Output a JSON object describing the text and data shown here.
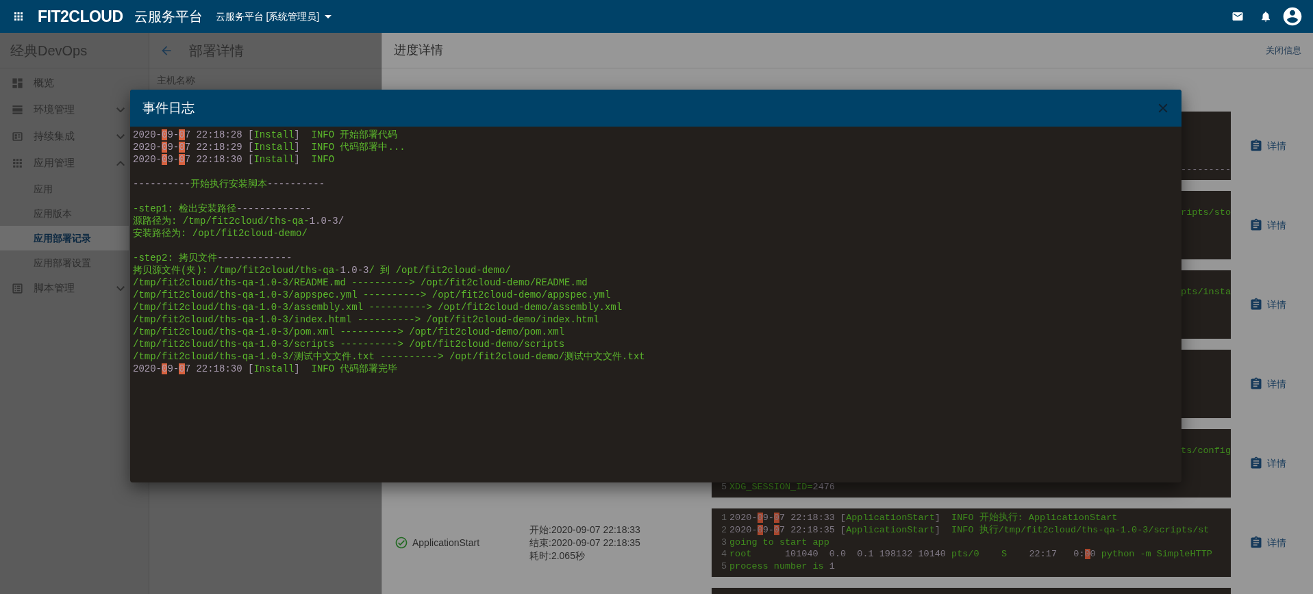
{
  "topbar": {
    "logo": "FIT2CLOUD",
    "title": "云服务平台",
    "workspace": "云服务平台 [系统管理员]"
  },
  "sidebar": {
    "title": "经典DevOps",
    "items": [
      {
        "label": "概览",
        "selected": false
      },
      {
        "label": "环境管理",
        "selected": false,
        "expanded": false
      },
      {
        "label": "持续集成",
        "selected": false,
        "expanded": false
      },
      {
        "label": "应用管理",
        "selected": false,
        "expanded": true,
        "children": [
          {
            "label": "应用",
            "selected": false
          },
          {
            "label": "应用版本",
            "selected": false
          },
          {
            "label": "应用部署记录",
            "selected": true
          },
          {
            "label": "应用部署设置",
            "selected": false
          }
        ]
      },
      {
        "label": "脚本管理",
        "selected": false,
        "expanded": false
      }
    ]
  },
  "detail_panel": {
    "title": "部署详情",
    "field_label": "主机名称"
  },
  "progress": {
    "title": "进度详情",
    "close_label": "关闭信息",
    "rows": [
      {
        "output": [
          {
            "segments": [
              {
                "kind": "dim",
                "text": "---------"
              }
            ]
          }
        ],
        "detail": "详情"
      },
      {
        "output": [
          {
            "segments": [
              {
                "kind": "green",
                "text": "ripts/sto"
              }
            ]
          }
        ],
        "detail": "详情"
      },
      {
        "output": [
          {
            "segments": [
              {
                "kind": "green",
                "text": "pts/insta"
              }
            ]
          }
        ],
        "detail": "详情"
      },
      {
        "detail": "详情"
      },
      {
        "output": [
          {
            "segments": [
              {
                "kind": "green",
                "text": "ts/config"
              }
            ]
          },
          {
            "number": "5",
            "segments": [
              {
                "kind": "green",
                "text": "XDG_SESSION_ID="
              },
              {
                "kind": "dim",
                "text": "2476"
              }
            ]
          }
        ],
        "detail": "详情"
      },
      {
        "event": "ApplicationStart",
        "completed": true,
        "times": [
          "开始:2020-09-07 22:18:33",
          "结束:2020-09-07 22:18:35",
          "耗时:2.065秒"
        ],
        "output": [
          {
            "number": "1",
            "segments": [
              {
                "kind": "dim",
                "text": "2020-"
              },
              {
                "kind": "mark",
                "text": "0"
              },
              {
                "kind": "dim",
                "text": "9-"
              },
              {
                "kind": "mark",
                "text": "0"
              },
              {
                "kind": "dim",
                "text": "7 22:18:33 ["
              },
              {
                "kind": "green",
                "text": "ApplicationStart"
              },
              {
                "kind": "dim",
                "text": "]"
              },
              {
                "kind": "green",
                "text": "  INFO 开始执行: ApplicationStart"
              }
            ]
          },
          {
            "number": "2",
            "segments": [
              {
                "kind": "dim",
                "text": "2020-"
              },
              {
                "kind": "mark",
                "text": "0"
              },
              {
                "kind": "dim",
                "text": "9-"
              },
              {
                "kind": "mark",
                "text": "0"
              },
              {
                "kind": "dim",
                "text": "7 22:18:35 ["
              },
              {
                "kind": "green",
                "text": "ApplicationStart"
              },
              {
                "kind": "dim",
                "text": "]"
              },
              {
                "kind": "green",
                "text": "  INFO 执行/tmp/fit2cloud/ths-qa-1.0-3/scripts/st"
              }
            ]
          },
          {
            "number": "3",
            "segments": [
              {
                "kind": "green",
                "text": "going to start app"
              }
            ]
          },
          {
            "number": "4",
            "segments": [
              {
                "kind": "green",
                "text": "root"
              },
              {
                "kind": "dim",
                "text": "      101040  0.0  0.1 198132 10140 "
              },
              {
                "kind": "green",
                "text": "pts/0    S"
              },
              {
                "kind": "dim",
                "text": "    22:17   0:"
              },
              {
                "kind": "mark",
                "text": "0"
              },
              {
                "kind": "dim",
                "text": "0 "
              },
              {
                "kind": "green",
                "text": "python -m SimpleHTTP"
              }
            ]
          },
          {
            "number": "5",
            "segments": [
              {
                "kind": "green",
                "text": "process number is "
              },
              {
                "kind": "dim",
                "text": "1"
              }
            ]
          }
        ],
        "detail": "详情"
      }
    ]
  },
  "modal": {
    "title": "事件日志",
    "lines": [
      {
        "segments": [
          {
            "kind": "dim",
            "text": "2020-"
          },
          {
            "kind": "mark",
            "text": "0"
          },
          {
            "kind": "dim",
            "text": "9-"
          },
          {
            "kind": "mark",
            "text": "0"
          },
          {
            "kind": "dim",
            "text": "7 22:18:28 ["
          },
          {
            "kind": "green",
            "text": "Install"
          },
          {
            "kind": "dim",
            "text": "]"
          },
          {
            "kind": "green",
            "text": "  INFO 开始部署代码"
          }
        ]
      },
      {
        "segments": [
          {
            "kind": "dim",
            "text": "2020-"
          },
          {
            "kind": "mark",
            "text": "0"
          },
          {
            "kind": "dim",
            "text": "9-"
          },
          {
            "kind": "mark",
            "text": "0"
          },
          {
            "kind": "dim",
            "text": "7 22:18:29 ["
          },
          {
            "kind": "green",
            "text": "Install"
          },
          {
            "kind": "dim",
            "text": "]"
          },
          {
            "kind": "green",
            "text": "  INFO 代码部署中..."
          }
        ]
      },
      {
        "segments": [
          {
            "kind": "dim",
            "text": "2020-"
          },
          {
            "kind": "mark",
            "text": "0"
          },
          {
            "kind": "dim",
            "text": "9-"
          },
          {
            "kind": "mark",
            "text": "0"
          },
          {
            "kind": "dim",
            "text": "7 22:18:30 ["
          },
          {
            "kind": "green",
            "text": "Install"
          },
          {
            "kind": "dim",
            "text": "]"
          },
          {
            "kind": "green",
            "text": "  INFO"
          }
        ]
      },
      {
        "kind": "blank"
      },
      {
        "segments": [
          {
            "kind": "dim",
            "text": "----------"
          },
          {
            "kind": "green",
            "text": "开始执行安装脚本"
          },
          {
            "kind": "dim",
            "text": "----------"
          }
        ]
      },
      {
        "kind": "blank"
      },
      {
        "segments": [
          {
            "kind": "green",
            "text": "-step1: 检出安装路径"
          },
          {
            "kind": "dim",
            "text": "-------------"
          }
        ]
      },
      {
        "segments": [
          {
            "kind": "green",
            "text": "源路径为: /tmp/fit2cloud/ths-qa-"
          },
          {
            "kind": "dim",
            "text": "1.0-3/"
          }
        ]
      },
      {
        "segments": [
          {
            "kind": "green",
            "text": "安装路径为: /opt/fit2cloud-demo/"
          }
        ]
      },
      {
        "kind": "blank"
      },
      {
        "segments": [
          {
            "kind": "green",
            "text": "-step2: 拷贝文件"
          },
          {
            "kind": "dim",
            "text": "-------------"
          }
        ]
      },
      {
        "segments": [
          {
            "kind": "green",
            "text": "拷贝源文件(夹): /tmp/fit2cloud/ths-qa-"
          },
          {
            "kind": "dim",
            "text": "1.0-3"
          },
          {
            "kind": "green",
            "text": "/ 到 /opt/fit2cloud-demo/"
          }
        ]
      },
      {
        "segments": [
          {
            "kind": "green",
            "text": "/tmp/fit2cloud/ths-qa-1.0-3/README.md ----------> /opt/fit2cloud-demo/README.md"
          }
        ]
      },
      {
        "segments": [
          {
            "kind": "green",
            "text": "/tmp/fit2cloud/ths-qa-1.0-3/appspec.yml ----------> /opt/fit2cloud-demo/appspec.yml"
          }
        ]
      },
      {
        "segments": [
          {
            "kind": "green",
            "text": "/tmp/fit2cloud/ths-qa-1.0-3/assembly.xml ----------> /opt/fit2cloud-demo/assembly.xml"
          }
        ]
      },
      {
        "segments": [
          {
            "kind": "green",
            "text": "/tmp/fit2cloud/ths-qa-1.0-3/index.html ----------> /opt/fit2cloud-demo/index.html"
          }
        ]
      },
      {
        "segments": [
          {
            "kind": "green",
            "text": "/tmp/fit2cloud/ths-qa-1.0-3/pom.xml ----------> /opt/fit2cloud-demo/pom.xml"
          }
        ]
      },
      {
        "segments": [
          {
            "kind": "green",
            "text": "/tmp/fit2cloud/ths-qa-1.0-3/scripts ----------> /opt/fit2cloud-demo/scripts"
          }
        ]
      },
      {
        "segments": [
          {
            "kind": "green",
            "text": "/tmp/fit2cloud/ths-qa-1.0-3/测试中文文件.txt ----------> /opt/fit2cloud-demo/测试中文文件.txt"
          }
        ]
      },
      {
        "segments": [
          {
            "kind": "dim",
            "text": "2020-"
          },
          {
            "kind": "mark",
            "text": "0"
          },
          {
            "kind": "dim",
            "text": "9-"
          },
          {
            "kind": "mark",
            "text": "0"
          },
          {
            "kind": "dim",
            "text": "7 22:18:30 ["
          },
          {
            "kind": "green",
            "text": "Install"
          },
          {
            "kind": "dim",
            "text": "]"
          },
          {
            "kind": "green",
            "text": "  INFO 代码部署完毕"
          }
        ]
      }
    ]
  }
}
